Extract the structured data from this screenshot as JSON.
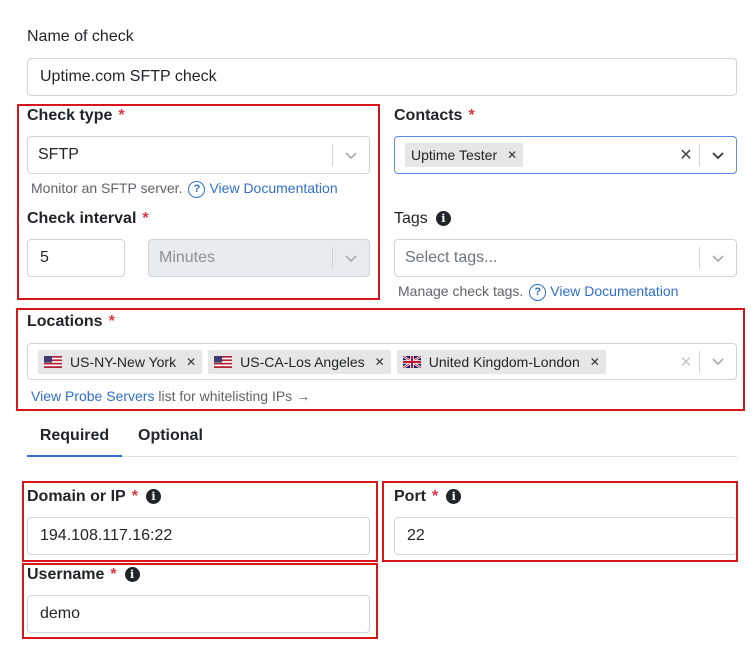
{
  "name_of_check": {
    "label": "Name of check",
    "value": "Uptime.com SFTP check"
  },
  "check_type": {
    "label": "Check type",
    "required": "*",
    "value": "SFTP",
    "help_text": "Monitor an SFTP server.",
    "help_link": "View Documentation"
  },
  "contacts": {
    "label": "Contacts",
    "required": "*",
    "chips": [
      "Uptime Tester"
    ]
  },
  "check_interval": {
    "label": "Check interval",
    "required": "*",
    "value": "5",
    "unit": "Minutes"
  },
  "tags": {
    "label": "Tags",
    "placeholder": "Select tags...",
    "help_text": "Manage check tags.",
    "help_link": "View Documentation"
  },
  "locations": {
    "label": "Locations",
    "required": "*",
    "chips": [
      {
        "flag": "us-flag-icon",
        "label": "US-NY-New York"
      },
      {
        "flag": "us-flag-icon",
        "label": "US-CA-Los Angeles"
      },
      {
        "flag": "uk-flag-icon",
        "label": "United Kingdom-London"
      }
    ],
    "probe_link": "View Probe Servers",
    "probe_text": "list for whitelisting IPs →"
  },
  "tabs": [
    {
      "label": "Required",
      "active": true
    },
    {
      "label": "Optional",
      "active": false
    }
  ],
  "domain": {
    "label": "Domain or IP",
    "required": "*",
    "value": "194.108.117.16:22"
  },
  "port": {
    "label": "Port",
    "required": "*",
    "value": "22"
  },
  "username": {
    "label": "Username",
    "required": "*",
    "value": "demo"
  },
  "colors": {
    "accent": "#2f6fcf",
    "required": "#dc3545",
    "highlight_box": "#d6161a",
    "focus_border": "#5b8def"
  }
}
